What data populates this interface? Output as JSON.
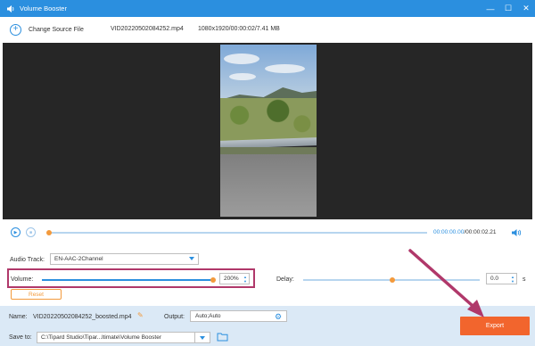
{
  "window": {
    "title": "Volume Booster",
    "controls": [
      "—",
      "☐",
      "✕"
    ]
  },
  "infobar": {
    "change_source_label": "Change Source File",
    "file_name": "VID20220502084252.mp4",
    "file_meta": "1080x1920/00:00:02/7.41 MB"
  },
  "playback": {
    "current_time": "00:00:00.00",
    "duration": "/00:00:02.21",
    "progress": 0.0
  },
  "audio": {
    "audio_track_label": "Audio Track:",
    "audio_track_value": "EN-AAC-2Channel",
    "volume_label": "Volume:",
    "volume_value": "200%",
    "volume_fraction": 1.0,
    "delay_label": "Delay:",
    "delay_value": "0.0",
    "delay_unit": "s",
    "delay_fraction": 0.5,
    "reset_label": "Reset"
  },
  "bottom": {
    "name_label": "Name:",
    "name_value": "VID20220502084252_boosted.mp4",
    "output_label": "Output:",
    "output_value": "Auto;Auto",
    "saveto_label": "Save to:",
    "saveto_value": "C:\\Tipard Studio\\Tipar...ltimate\\Volume Booster",
    "export_label": "Export"
  },
  "colors": {
    "accent": "#2b8fdf",
    "knob": "#f39a3c",
    "export": "#f2652d",
    "highlight": "#b0386a"
  }
}
